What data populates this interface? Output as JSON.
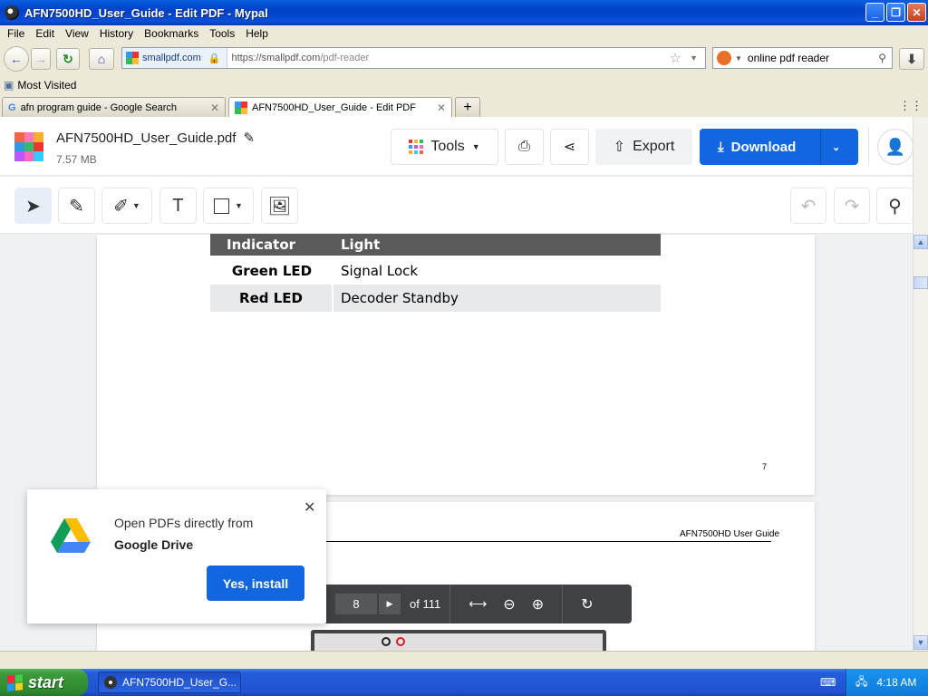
{
  "window": {
    "title": "AFN7500HD_User_Guide - Edit PDF - Mypal"
  },
  "menu": [
    "File",
    "Edit",
    "View",
    "History",
    "Bookmarks",
    "Tools",
    "Help"
  ],
  "nav": {
    "site_label": "smallpdf.com",
    "url_prefix": "https://smallpdf.com",
    "url_path": "/pdf-reader",
    "search_value": "online pdf reader"
  },
  "bookmarks": {
    "most_visited": "Most Visited"
  },
  "tabs": [
    {
      "label": "afn program guide - Google Search"
    },
    {
      "label": "AFN7500HD_User_Guide - Edit PDF"
    }
  ],
  "app": {
    "file_name": "AFN7500HD_User_Guide.pdf",
    "file_size": "7.57 MB",
    "tools_label": "Tools",
    "export_label": "Export",
    "download_label": "Download"
  },
  "document": {
    "table_header": [
      "Indicator",
      "Light"
    ],
    "table_rows": [
      [
        "Green LED",
        "Signal Lock"
      ],
      [
        "Red  LED",
        "Decoder Standby"
      ]
    ],
    "page_number": "7",
    "next_page_header": "AFN7500HD User Guide"
  },
  "viewer": {
    "current_page": "8",
    "total_pages": "of 111"
  },
  "popup": {
    "line1": "Open PDFs directly from",
    "line2": "Google Drive",
    "button": "Yes, install"
  },
  "taskbar": {
    "start": "start",
    "task": "AFN7500HD_User_G...",
    "clock": "4:18 AM"
  },
  "colors": {
    "accent": "#1267e0",
    "header_gray": "#5a5a5a"
  }
}
